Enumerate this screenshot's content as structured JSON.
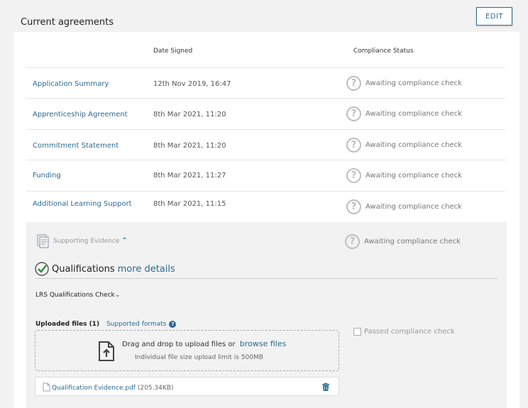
{
  "header": {
    "title": "Current agreements",
    "edit_label": "EDIT"
  },
  "table": {
    "col_date": "Date Signed",
    "col_status": "Compliance Status",
    "rows": [
      {
        "name": "Application Summary",
        "date": "12th Nov 2019, 16:47",
        "status": "Awaiting compliance check"
      },
      {
        "name": "Apprenticeship Agreement",
        "date": "8th Mar 2021, 11:20",
        "status": "Awaiting compliance check"
      },
      {
        "name": "Commitment Statement",
        "date": "8th Mar 2021, 11:20",
        "status": "Awaiting compliance check"
      },
      {
        "name": "Funding",
        "date": "8th Mar 2021, 11:27",
        "status": "Awaiting compliance check"
      },
      {
        "name": "Additional Learning Support",
        "date": "8th Mar 2021, 11:15",
        "status": "Awaiting compliance check"
      }
    ]
  },
  "evidence": {
    "label": "Supporting Evidence",
    "status": "Awaiting compliance check",
    "qualifications_title": "Qualifications",
    "more_details": "more details",
    "lrs_label": "LRS Qualifications Check",
    "uploaded_label": "Uploaded files (1)",
    "supported_formats": "Supported formats",
    "drop_text": "Drag and drop to upload files or",
    "browse_label": "browse files",
    "limit_text": "Individual file size upload limit is 500MB",
    "passed_label": "Passed compliance check",
    "file_name": "Qualification Evidence.pdf",
    "file_size": "(205.34KB)"
  },
  "colors": {
    "accent": "#2c6a8f",
    "success": "#2e8b3d"
  },
  "icons": [
    "question-circle-icon",
    "document-icon",
    "chevron-up-icon",
    "check-circle-icon",
    "chevron-down-icon",
    "help-icon",
    "upload-file-icon",
    "pdf-icon",
    "trash-icon"
  ]
}
